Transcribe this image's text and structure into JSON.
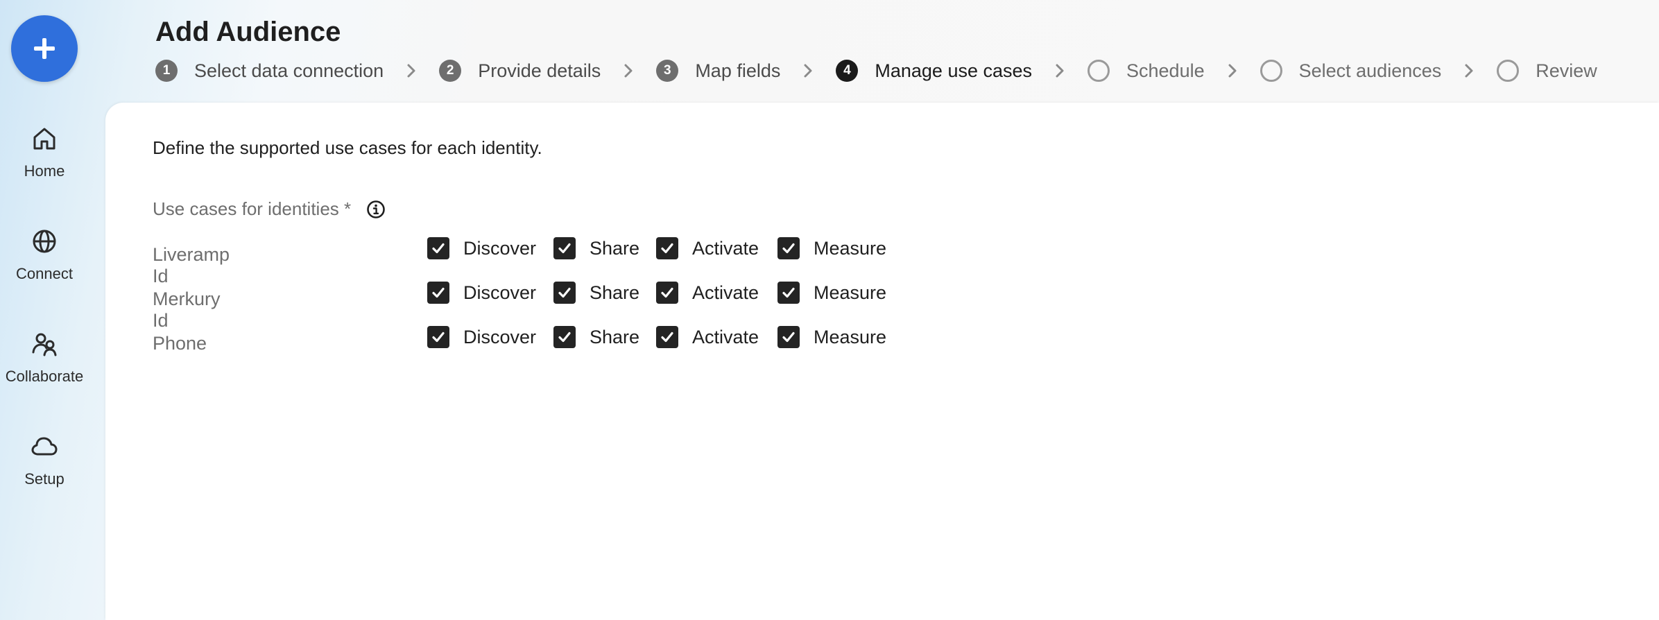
{
  "rail": {
    "create_icon": "plus-icon",
    "items": [
      {
        "label": "Home",
        "icon": "home-icon"
      },
      {
        "label": "Connect",
        "icon": "globe-icon"
      },
      {
        "label": "Collaborate",
        "icon": "people-icon"
      },
      {
        "label": "Setup",
        "icon": "cloud-icon"
      }
    ]
  },
  "header": {
    "title": "Add Audience",
    "steps": [
      {
        "number": "1",
        "label": "Select data connection",
        "state": "completed"
      },
      {
        "number": "2",
        "label": "Provide details",
        "state": "completed"
      },
      {
        "number": "3",
        "label": "Map fields",
        "state": "completed"
      },
      {
        "number": "4",
        "label": "Manage use cases",
        "state": "current"
      },
      {
        "number": "",
        "label": "Schedule",
        "state": "upcoming"
      },
      {
        "number": "",
        "label": "Select audiences",
        "state": "upcoming"
      },
      {
        "number": "",
        "label": "Review",
        "state": "upcoming"
      }
    ]
  },
  "content": {
    "description": "Define the supported use cases for each identity.",
    "field_label": "Use cases for identities *",
    "info_icon": "info-icon",
    "options": [
      "Discover",
      "Share",
      "Activate",
      "Measure"
    ],
    "identities": [
      {
        "label": "Liveramp Id",
        "checked": [
          true,
          true,
          true,
          true
        ]
      },
      {
        "label": "Merkury Id",
        "checked": [
          true,
          true,
          true,
          true
        ]
      },
      {
        "label": "Phone",
        "checked": [
          true,
          true,
          true,
          true
        ]
      }
    ]
  },
  "colors": {
    "accent": "#2f6fdc",
    "checkbox": "#242424",
    "muted_text": "#6e6e6e"
  }
}
